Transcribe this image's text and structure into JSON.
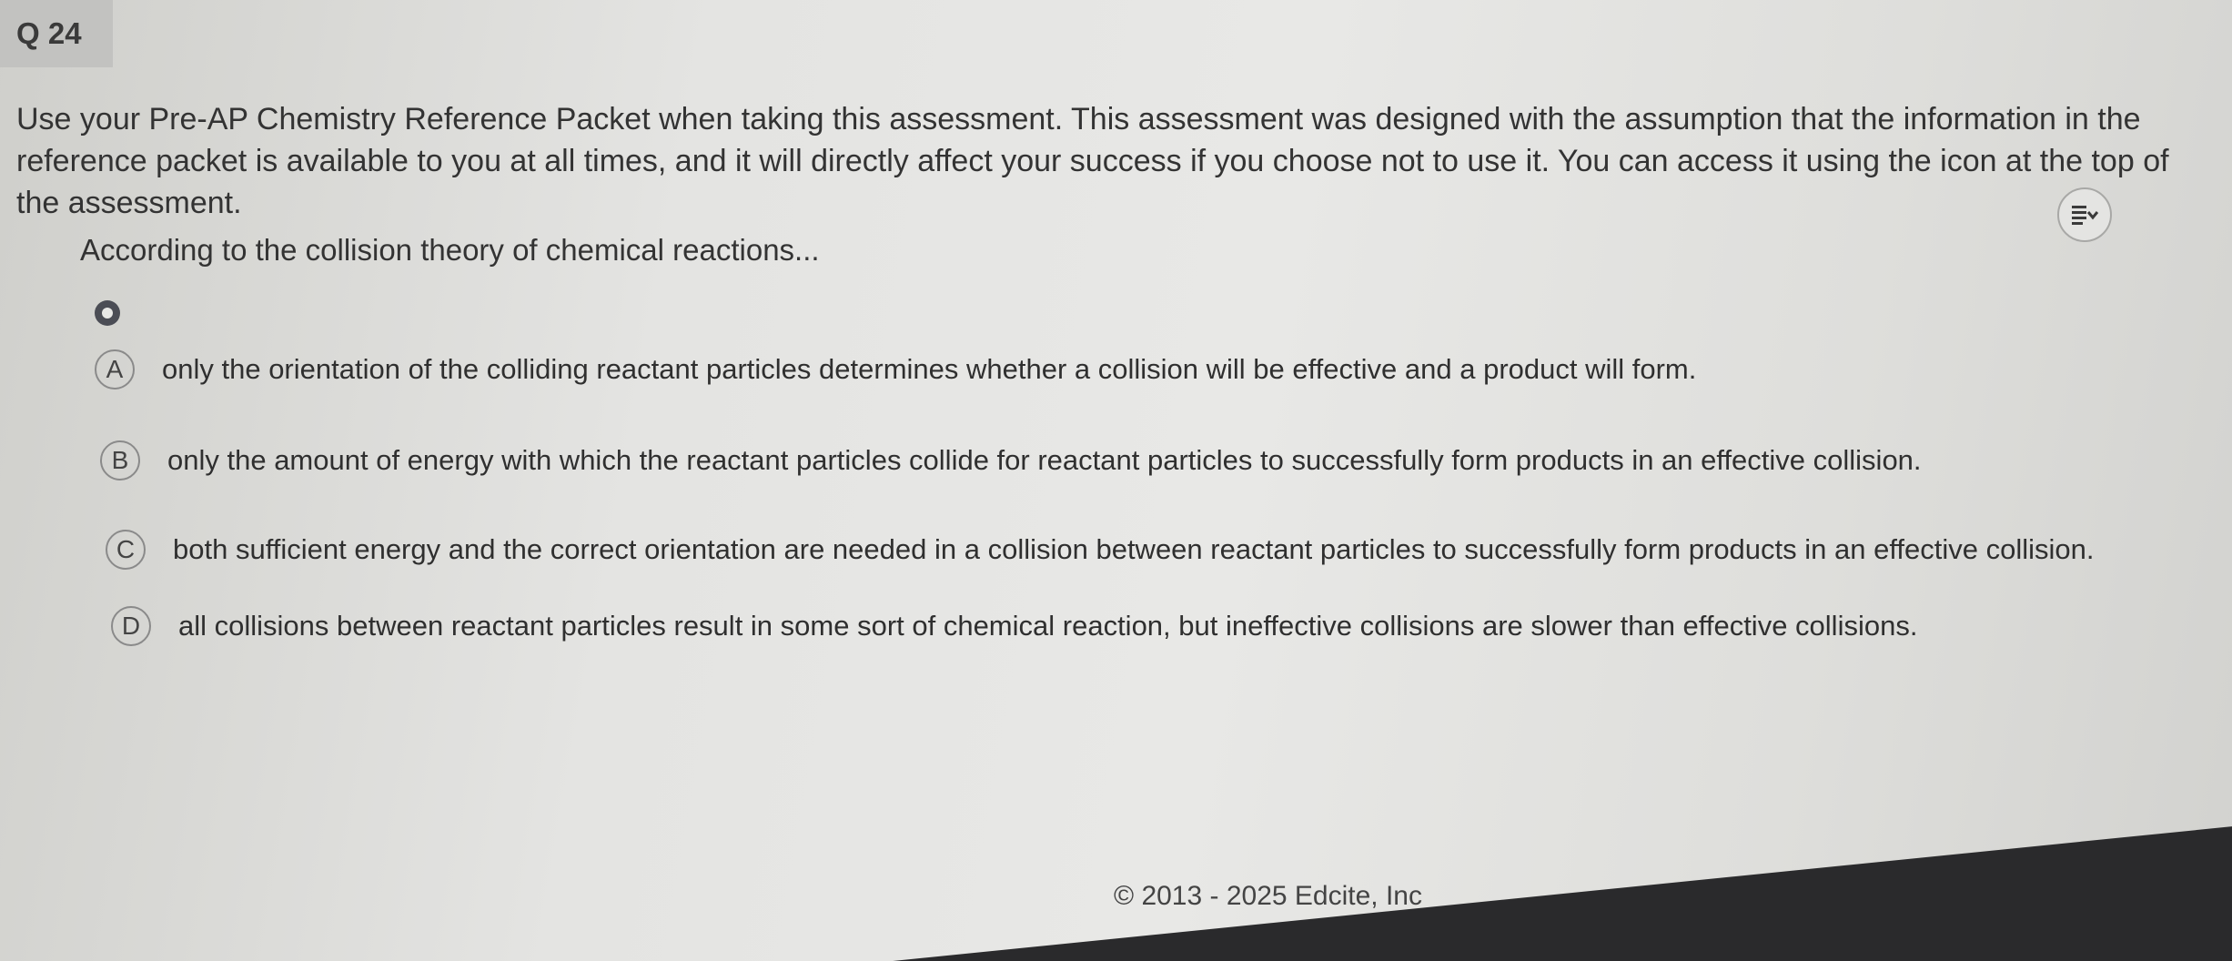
{
  "question": {
    "badge": "Q 24",
    "instructions": "Use your Pre-AP Chemistry Reference Packet when taking this assessment. This assessment was designed with the assumption that the information in the reference packet is available to you at all times, and it will directly affect your success if you choose not to use it. You can access it using the icon at the top of the assessment.",
    "prompt": "According to the collision theory of chemical reactions...",
    "tts_icon": "text-to-speech-menu-icon",
    "hint_icon": "hint-dot-icon"
  },
  "choices": [
    {
      "letter": "A",
      "text": "only the orientation of the colliding reactant particles determines whether a collision will be effective and a product will form."
    },
    {
      "letter": "B",
      "text": "only the amount of energy with which the reactant particles collide for reactant particles to successfully form products in an effective collision."
    },
    {
      "letter": "C",
      "text": "both sufficient energy and the correct orientation are needed in a collision between reactant particles to successfully form products in an effective collision."
    },
    {
      "letter": "D",
      "text": "all collisions between reactant particles result in some sort of chemical reaction, but ineffective collisions are slower than effective collisions."
    }
  ],
  "footer": {
    "copyright": "© 2013 - 2025 Edcite, Inc"
  },
  "colors": {
    "badge_bg": "#c2c2c0",
    "page_bg": "#e4e4e2",
    "text": "#2d2d2d"
  }
}
